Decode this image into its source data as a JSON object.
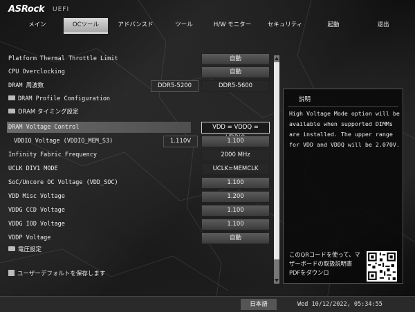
{
  "header": {
    "logo": "ASRock",
    "uefi": "UEFI"
  },
  "menu": [
    {
      "label": "メイン"
    },
    {
      "label": "OCツール"
    },
    {
      "label": "アドバンスド"
    },
    {
      "label": "ツール"
    },
    {
      "label": "H/W モニター"
    },
    {
      "label": "セキュリティ"
    },
    {
      "label": "起動"
    },
    {
      "label": "退出"
    }
  ],
  "active_tab": "OCツール",
  "settings": [
    {
      "label": "Platform Thermal Throttle Limit",
      "value": "自動"
    },
    {
      "label": "CPU Overclocking",
      "value": "自動"
    },
    {
      "label": "DRAM 周波数",
      "current": "DDR5-5200",
      "value": "DDR5-5600"
    },
    {
      "label": "DRAM Profile Configuration"
    },
    {
      "label": "DRAM タイミング設定"
    },
    {
      "label": "DRAM Voltage Control",
      "value": "VDD = VDDQ = VDDIO"
    },
    {
      "label": "VDDIO Voltage (VDDIO_MEM_S3)",
      "current": "1.110V",
      "value": "1.100"
    },
    {
      "label": "Infinity Fabric Frequency",
      "value": "2000 MHz"
    },
    {
      "label": "UCLK DIV1 MODE",
      "value": "UCLK=MEMCLK"
    },
    {
      "label": "SoC/Uncore OC Voltage (VDD_SOC)",
      "value": "1.100"
    },
    {
      "label": "VDD Misc Voltage",
      "value": "1.200"
    },
    {
      "label": "VDDG CCD Voltage",
      "value": "1.100"
    },
    {
      "label": "VDDG IOD Voltage",
      "value": "1.100"
    },
    {
      "label": "VDDP Voltage",
      "value": "自動"
    },
    {
      "label": "電圧設定"
    }
  ],
  "save_default": "ユーザーデフォルトを保存します",
  "help": {
    "title": "説明",
    "text": "High Voltage Mode option will be available when supported DIMMs are installed. The upper range for VDD and VDDQ will be 2.070V.",
    "qr_text": "このQRコードを使って、マザーボードの取扱説明書PDFをダウンロ"
  },
  "footer": {
    "language": "日本語",
    "datetime": "Wed 10/12/2022, 05:34:55"
  }
}
